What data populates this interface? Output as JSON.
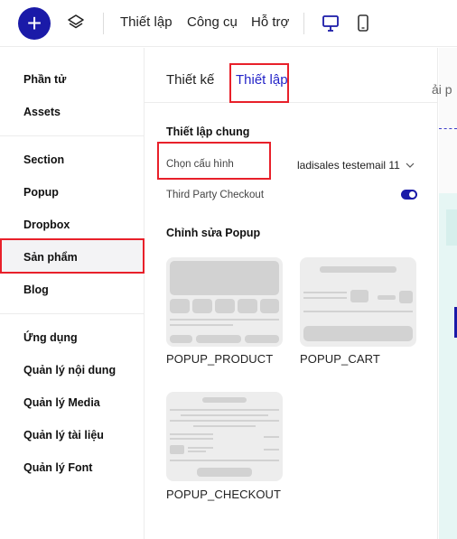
{
  "topbar": {
    "add_label": "+",
    "menu": [
      "Thiết lập",
      "Công cụ",
      "Hỗ trợ"
    ],
    "icons": [
      "plus-icon",
      "layers-icon",
      "desktop-icon",
      "mobile-icon"
    ]
  },
  "sidebar": {
    "group1": [
      "Phần tử",
      "Assets"
    ],
    "group2": [
      "Section",
      "Popup",
      "Dropbox",
      "Sản phẩm",
      "Blog"
    ],
    "group3": [
      "Ứng dụng",
      "Quản lý nội dung",
      "Quản lý Media",
      "Quản lý tài liệu",
      "Quản lý Font"
    ],
    "active": "Sản phẩm"
  },
  "panel": {
    "tabs": [
      "Thiết kế",
      "Thiết lập"
    ],
    "active_tab": "Thiết lập",
    "general_title": "Thiết lập chung",
    "config_label": "Chọn cấu hình",
    "config_value": "ladisales testemail 11",
    "third_party_label": "Third Party Checkout",
    "third_party_enabled": true,
    "popup_title": "Chỉnh sửa Popup",
    "popups": [
      "POPUP_PRODUCT",
      "POPUP_CART",
      "POPUP_CHECKOUT"
    ]
  },
  "canvas": {
    "visible_text": "ải p"
  },
  "colors": {
    "accent": "#1a1aa8",
    "active_tab": "#2525c8",
    "highlight_box": "#e8202a"
  }
}
